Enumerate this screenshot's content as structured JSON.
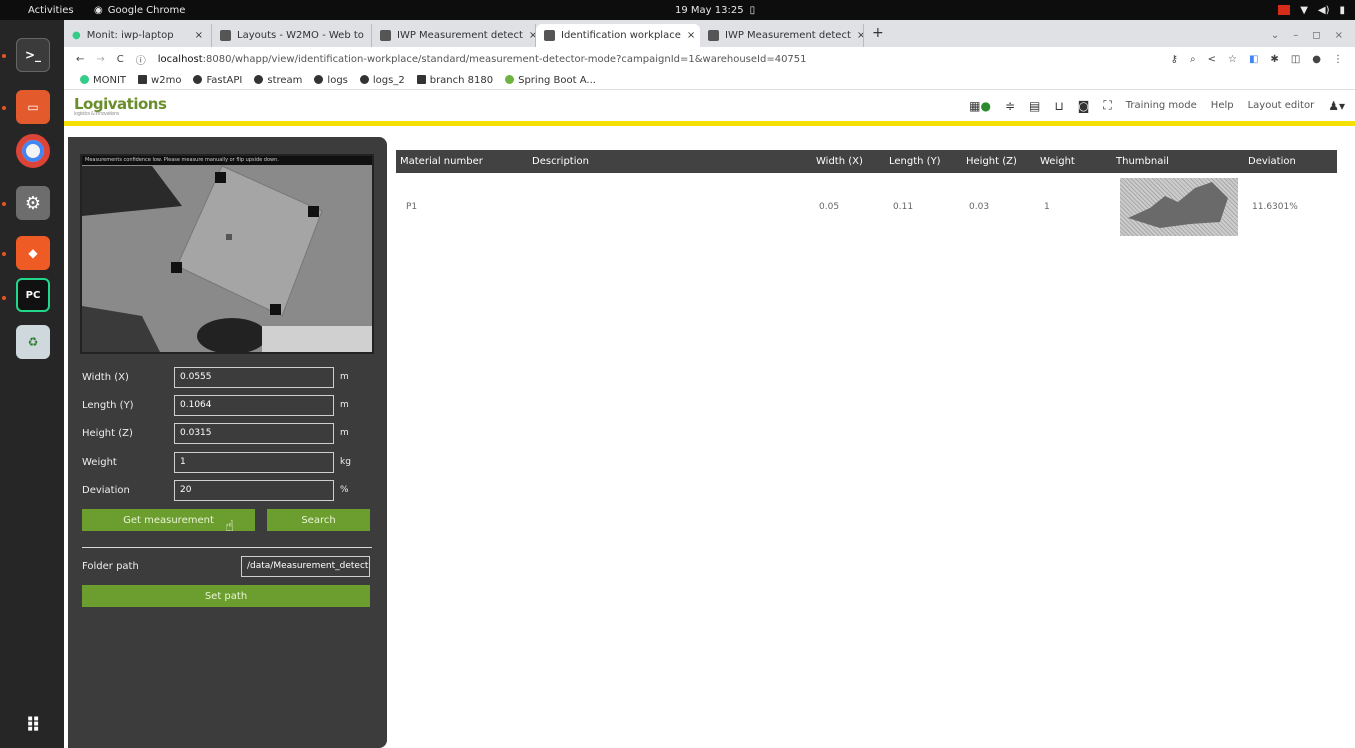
{
  "os": {
    "activities": "Activities",
    "app_name": "Google Chrome",
    "clock": "19 May 13:25"
  },
  "browser": {
    "tabs": [
      {
        "title": "Monit: iwp-laptop"
      },
      {
        "title": "Layouts - W2MO - Web to"
      },
      {
        "title": "IWP Measurement detect"
      },
      {
        "title": "Identification workplace"
      },
      {
        "title": "IWP Measurement detect"
      }
    ],
    "url_host": "localhost",
    "url_rest": ":8080/whapp/view/identification-workplace/standard/measurement-detector-mode?campaignId=1&warehouseId=40751",
    "bookmarks": [
      "MONIT",
      "w2mo",
      "FastAPI",
      "stream",
      "logs",
      "logs_2",
      "branch 8180",
      "Spring Boot A..."
    ]
  },
  "header": {
    "logo": "Logivations",
    "logo_tagline": "logistics & innovations",
    "links": [
      "Training mode",
      "Help",
      "Layout editor"
    ]
  },
  "camera": {
    "message": "Measurements confidence low. Please measure manually or flip upside down."
  },
  "form": {
    "fields": [
      {
        "label": "Width (X)",
        "value": "0.0555",
        "unit": "m"
      },
      {
        "label": "Length (Y)",
        "value": "0.1064",
        "unit": "m"
      },
      {
        "label": "Height (Z)",
        "value": "0.0315",
        "unit": "m"
      },
      {
        "label": "Weight",
        "value": "1",
        "unit": "kg"
      },
      {
        "label": "Deviation",
        "value": "20",
        "unit": "%"
      }
    ],
    "get_measurement": "Get measurement",
    "search": "Search",
    "folder_label": "Folder path",
    "folder_value": "/data/Measurement_detect",
    "set_path": "Set path"
  },
  "table": {
    "columns": [
      "Material number",
      "Description",
      "Width (X)",
      "Length (Y)",
      "Height (Z)",
      "Weight",
      "Thumbnail",
      "Deviation"
    ],
    "rows": [
      {
        "material": "P1",
        "description": "",
        "width": "0.05",
        "length": "0.11",
        "height": "0.03",
        "weight": "1",
        "deviation": "11.6301%"
      }
    ]
  }
}
